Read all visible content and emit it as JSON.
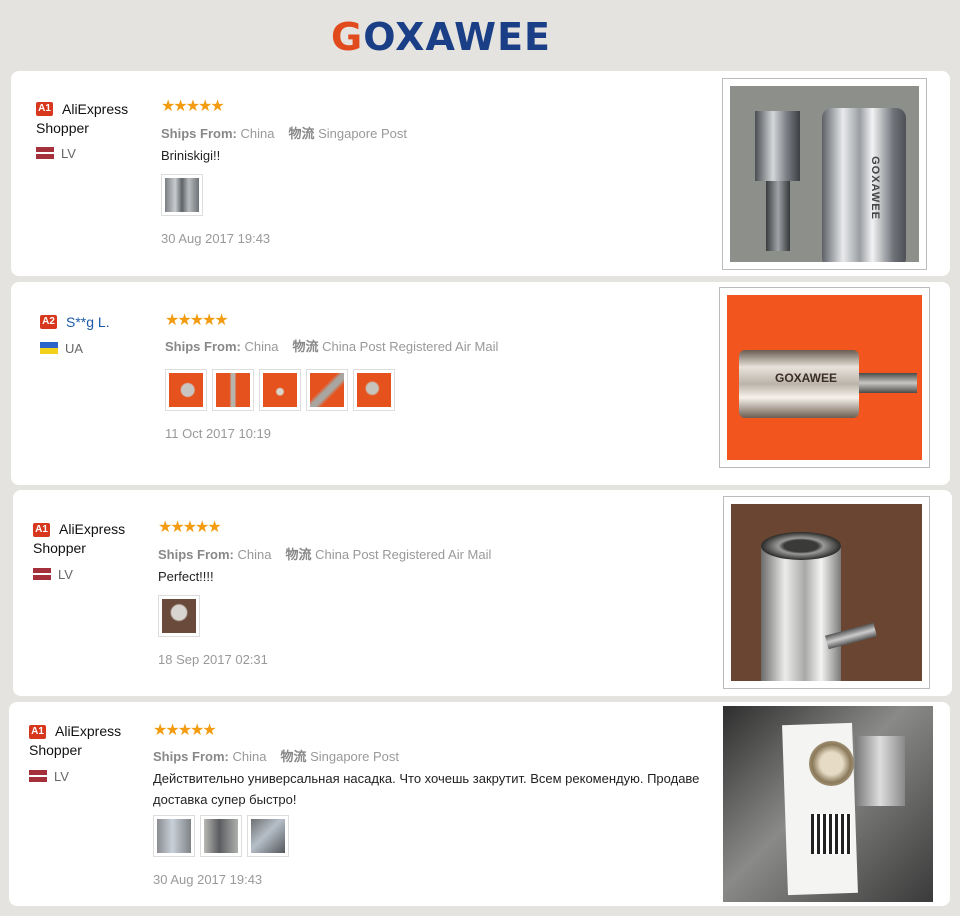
{
  "brand": {
    "logo_first": "G",
    "logo_rest": "OXAWEE"
  },
  "reviews": [
    {
      "badge": "A1",
      "name": "AliExpress Shopper",
      "country": "LV",
      "flag": "lv",
      "stars": "★★★★★",
      "ships_label": "Ships From:",
      "ships_value": "China",
      "logistics_label": "物流",
      "logistics_value": "Singapore Post",
      "text": "Briniskigi!!",
      "date": "30 Aug 2017 19:43"
    },
    {
      "badge": "A2",
      "name": "S**g L.",
      "country": "UA",
      "flag": "ua",
      "stars": "★★★★★",
      "ships_label": "Ships From:",
      "ships_value": "China",
      "logistics_label": "物流",
      "logistics_value": "China Post Registered Air Mail",
      "text": "",
      "date": "11 Oct 2017 10:19"
    },
    {
      "badge": "A1",
      "name": "AliExpress Shopper",
      "country": "LV",
      "flag": "lv",
      "stars": "★★★★★",
      "ships_label": "Ships From:",
      "ships_value": "China",
      "logistics_label": "物流",
      "logistics_value": "China Post Registered Air Mail",
      "text": "Perfect!!!!",
      "date": "18 Sep 2017 02:31"
    },
    {
      "badge": "A1",
      "name": "AliExpress Shopper",
      "country": "LV",
      "flag": "lv",
      "stars": "★★★★★",
      "ships_label": "Ships From:",
      "ships_value": "China",
      "logistics_label": "物流",
      "logistics_value": "Singapore Post",
      "text": "Действительно универсальная насадка. Что хочешь закрутит. Всем рекомендую. Продаве",
      "text2": "доставка супер быстро!",
      "date": "30 Aug 2017 19:43"
    }
  ],
  "photo_text": {
    "brand_on_socket": "GOXAWEE",
    "brand_on_socket_2": "GOXAWEE"
  },
  "colors": {
    "accent": "#d6371d",
    "star": "#f39c12",
    "brand_blue": "#1b3f86",
    "brand_orange": "#e04a1d"
  }
}
